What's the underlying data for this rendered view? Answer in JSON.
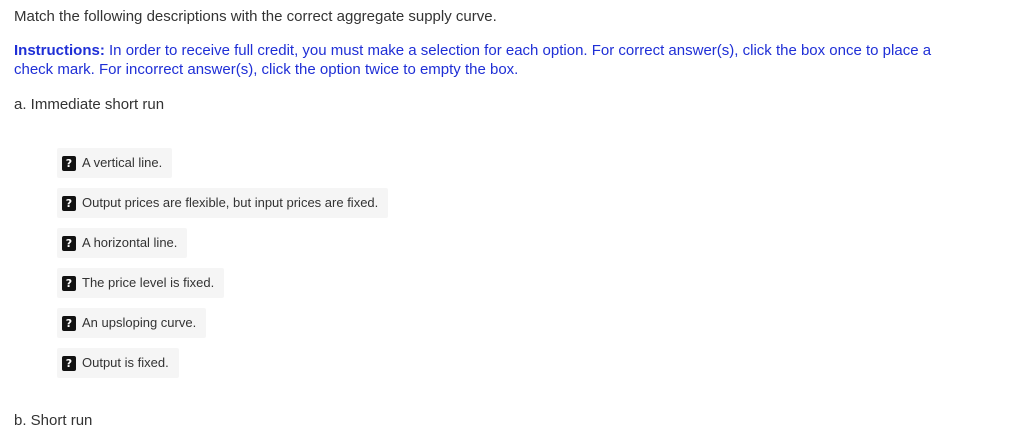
{
  "prompt": "Match the following descriptions with the correct aggregate supply curve.",
  "instructions": {
    "lead": "Instructions:",
    "text": " In order to receive full credit, you must make a selection for each option. For correct answer(s), click the box once to place a check mark. For incorrect answer(s), click the option twice to empty the box."
  },
  "parts": [
    {
      "label": "a. Immediate short run"
    },
    {
      "label": "b. Short run"
    }
  ],
  "option_icon": "question-mark-icon",
  "options": [
    {
      "mark": "?",
      "text": "A vertical line."
    },
    {
      "mark": "?",
      "text": "Output prices are flexible, but input prices are fixed."
    },
    {
      "mark": "?",
      "text": "A horizontal line."
    },
    {
      "mark": "?",
      "text": "The price level is fixed."
    },
    {
      "mark": "?",
      "text": "An upsloping curve."
    },
    {
      "mark": "?",
      "text": "Output is fixed."
    }
  ],
  "colors": {
    "instruction_text": "#1f2fd6",
    "body_text": "#333333",
    "option_background": "#f5f5f5",
    "question_box": "#111111"
  }
}
